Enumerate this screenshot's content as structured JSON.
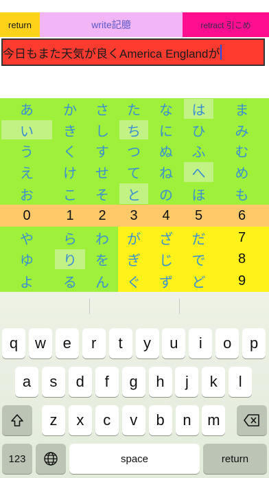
{
  "toolbar": {
    "return_label": "return",
    "write_label": "write記臆",
    "retract_label": "retract  引こめ"
  },
  "text_field": {
    "value": "今日もまた天気が良くAmerica Englandが"
  },
  "kana_grid": {
    "rows": [
      [
        "あ",
        "か",
        "さ",
        "た",
        "な",
        "は",
        "ま"
      ],
      [
        "い",
        "き",
        "し",
        "ち",
        "に",
        "ひ",
        "み"
      ],
      [
        "う",
        "く",
        "す",
        "つ",
        "ぬ",
        "ふ",
        "む"
      ],
      [
        "え",
        "け",
        "せ",
        "て",
        "ね",
        "へ",
        "め"
      ],
      [
        "お",
        "こ",
        "そ",
        "と",
        "の",
        "ほ",
        "も"
      ],
      [
        "0",
        "1",
        "2",
        "3",
        "4",
        "5",
        "6"
      ],
      [
        "や",
        "ら",
        "わ",
        "が",
        "ざ",
        "だ",
        "7"
      ],
      [
        "ゆ",
        "り",
        "を",
        "ぎ",
        "じ",
        "で",
        "8"
      ],
      [
        "よ",
        "る",
        "ん",
        "ぐ",
        "ず",
        "ど",
        "9"
      ]
    ]
  },
  "keyboard": {
    "row1": [
      "q",
      "w",
      "e",
      "r",
      "t",
      "y",
      "u",
      "i",
      "o",
      "p"
    ],
    "row2": [
      "a",
      "s",
      "d",
      "f",
      "g",
      "h",
      "j",
      "k",
      "l"
    ],
    "row3": [
      "z",
      "x",
      "c",
      "v",
      "b",
      "n",
      "m"
    ],
    "numbers_label": "123",
    "space_label": "space",
    "return_label": "return"
  },
  "colors": {
    "grid_green": "#9ef03a",
    "grid_highlight": "#c2f284",
    "number_row": "#ffc96a",
    "yellow_block": "#fff21a",
    "text_field_bg": "#ff3b30"
  }
}
